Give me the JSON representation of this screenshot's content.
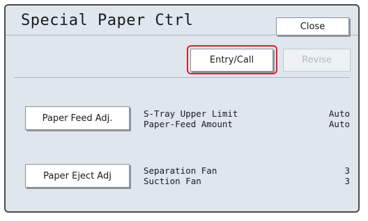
{
  "title": "Special Paper Ctrl",
  "buttons": {
    "close": "Close",
    "entry_call": "Entry/Call",
    "revise": "Revise"
  },
  "rows": [
    {
      "button": "Paper Feed Adj.",
      "items": [
        {
          "label": "S-Tray Upper Limit",
          "value": "Auto"
        },
        {
          "label": "Paper-Feed Amount",
          "value": "Auto"
        }
      ]
    },
    {
      "button": "Paper Eject Adj",
      "items": [
        {
          "label": "Separation Fan",
          "value": "3"
        },
        {
          "label": "Suction Fan",
          "value": "3"
        }
      ]
    }
  ],
  "colors": {
    "panel_bg": "#dfe6ee",
    "highlight_outline": "#e0202a",
    "disabled_text": "#b4b9bf"
  }
}
